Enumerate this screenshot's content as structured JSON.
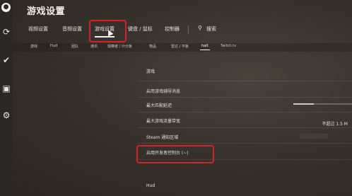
{
  "window": {
    "title": "游戏设置"
  },
  "tabs": [
    {
      "label": "视频设置"
    },
    {
      "label": "音频设置"
    },
    {
      "label": "游戏设置"
    },
    {
      "label": "键盘 / 鼠标"
    },
    {
      "label": "控制器"
    },
    {
      "label": "搜索"
    }
  ],
  "subtabs": [
    {
      "label": "游戏"
    },
    {
      "label": "Hud"
    },
    {
      "label": "团队"
    },
    {
      "label": "通讯"
    },
    {
      "label": "观察者 / 计分板"
    },
    {
      "label": "物品"
    },
    {
      "label": "雷达 / 平板"
    },
    {
      "label": "halt"
    },
    {
      "label": "Twitch.tv"
    }
  ],
  "panel": {
    "section_title": "游戏",
    "rows": [
      {
        "label": "启用游戏辅导消息"
      },
      {
        "label": "最大匹配延迟"
      },
      {
        "label": "最大游戏流量带宽",
        "value": "不超过 1.5 M"
      },
      {
        "label": "Steam 通知区域"
      },
      {
        "label": "启用开发者控制台 (~)"
      }
    ],
    "slider_value": 0.35,
    "next_section": "Hud"
  },
  "colors": {
    "highlight": "#d91f27"
  },
  "icons": {
    "rail": [
      "logo-icon",
      "refresh-icon",
      "check-icon",
      "briefcase-icon",
      "gear-icon"
    ],
    "search": "search-icon"
  }
}
